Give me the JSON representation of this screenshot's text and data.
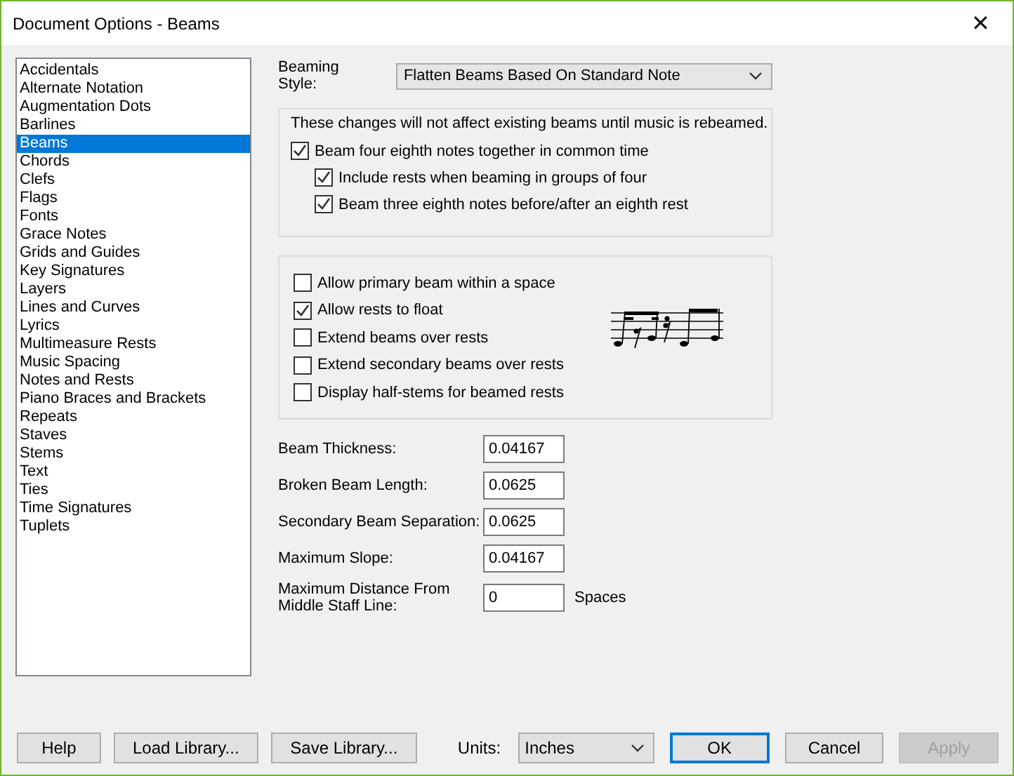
{
  "window": {
    "title": "Document Options - Beams",
    "close": "✕"
  },
  "categories": [
    {
      "label": "Accidentals",
      "selected": false
    },
    {
      "label": "Alternate Notation",
      "selected": false
    },
    {
      "label": "Augmentation Dots",
      "selected": false
    },
    {
      "label": "Barlines",
      "selected": false
    },
    {
      "label": "Beams",
      "selected": true
    },
    {
      "label": "Chords",
      "selected": false
    },
    {
      "label": "Clefs",
      "selected": false
    },
    {
      "label": "Flags",
      "selected": false
    },
    {
      "label": "Fonts",
      "selected": false
    },
    {
      "label": "Grace Notes",
      "selected": false
    },
    {
      "label": "Grids and Guides",
      "selected": false
    },
    {
      "label": "Key Signatures",
      "selected": false
    },
    {
      "label": "Layers",
      "selected": false
    },
    {
      "label": "Lines and Curves",
      "selected": false
    },
    {
      "label": "Lyrics",
      "selected": false
    },
    {
      "label": "Multimeasure Rests",
      "selected": false
    },
    {
      "label": "Music Spacing",
      "selected": false
    },
    {
      "label": "Notes and Rests",
      "selected": false
    },
    {
      "label": "Piano Braces and Brackets",
      "selected": false
    },
    {
      "label": "Repeats",
      "selected": false
    },
    {
      "label": "Staves",
      "selected": false
    },
    {
      "label": "Stems",
      "selected": false
    },
    {
      "label": "Text",
      "selected": false
    },
    {
      "label": "Ties",
      "selected": false
    },
    {
      "label": "Time Signatures",
      "selected": false
    },
    {
      "label": "Tuplets",
      "selected": false
    }
  ],
  "beaming_style": {
    "label": "Beaming Style:",
    "value": "Flatten Beams Based On Standard Note"
  },
  "rebeam_group": {
    "note": "These changes will not affect existing beams until music is rebeamed.",
    "options": [
      {
        "label": "Beam four eighth notes together in common time",
        "checked": true,
        "children": [
          {
            "label": "Include rests when beaming in groups of four",
            "checked": true
          },
          {
            "label": "Beam three eighth notes before/after an eighth rest",
            "checked": true
          }
        ]
      }
    ]
  },
  "rest_options": [
    {
      "label": "Allow primary beam within a space",
      "checked": false
    },
    {
      "label": "Allow rests to float",
      "checked": true
    },
    {
      "label": "Extend beams over rests",
      "checked": false
    },
    {
      "label": "Extend secondary beams over rests",
      "checked": false
    },
    {
      "label": "Display half-stems for beamed rests",
      "checked": false
    }
  ],
  "fields": [
    {
      "label": "Beam Thickness:",
      "value": "0.04167"
    },
    {
      "label": "Broken Beam Length:",
      "value": "0.0625"
    },
    {
      "label": "Secondary Beam Separation:",
      "value": "0.0625"
    },
    {
      "label": "Maximum Slope:",
      "value": "0.04167"
    },
    {
      "label": "Maximum Distance From Middle Staff Line:",
      "value": "0",
      "unit": "Spaces"
    }
  ],
  "footer_left": [
    {
      "label": "Help",
      "disabled": false
    },
    {
      "label": "Load Library...",
      "disabled": false
    },
    {
      "label": "Save Library...",
      "disabled": false
    }
  ],
  "units": {
    "label": "Units:",
    "value": "Inches"
  },
  "footer_right": [
    {
      "label": "OK",
      "default": true,
      "disabled": false
    },
    {
      "label": "Cancel",
      "default": false,
      "disabled": false
    },
    {
      "label": "Apply",
      "default": false,
      "disabled": true
    }
  ]
}
